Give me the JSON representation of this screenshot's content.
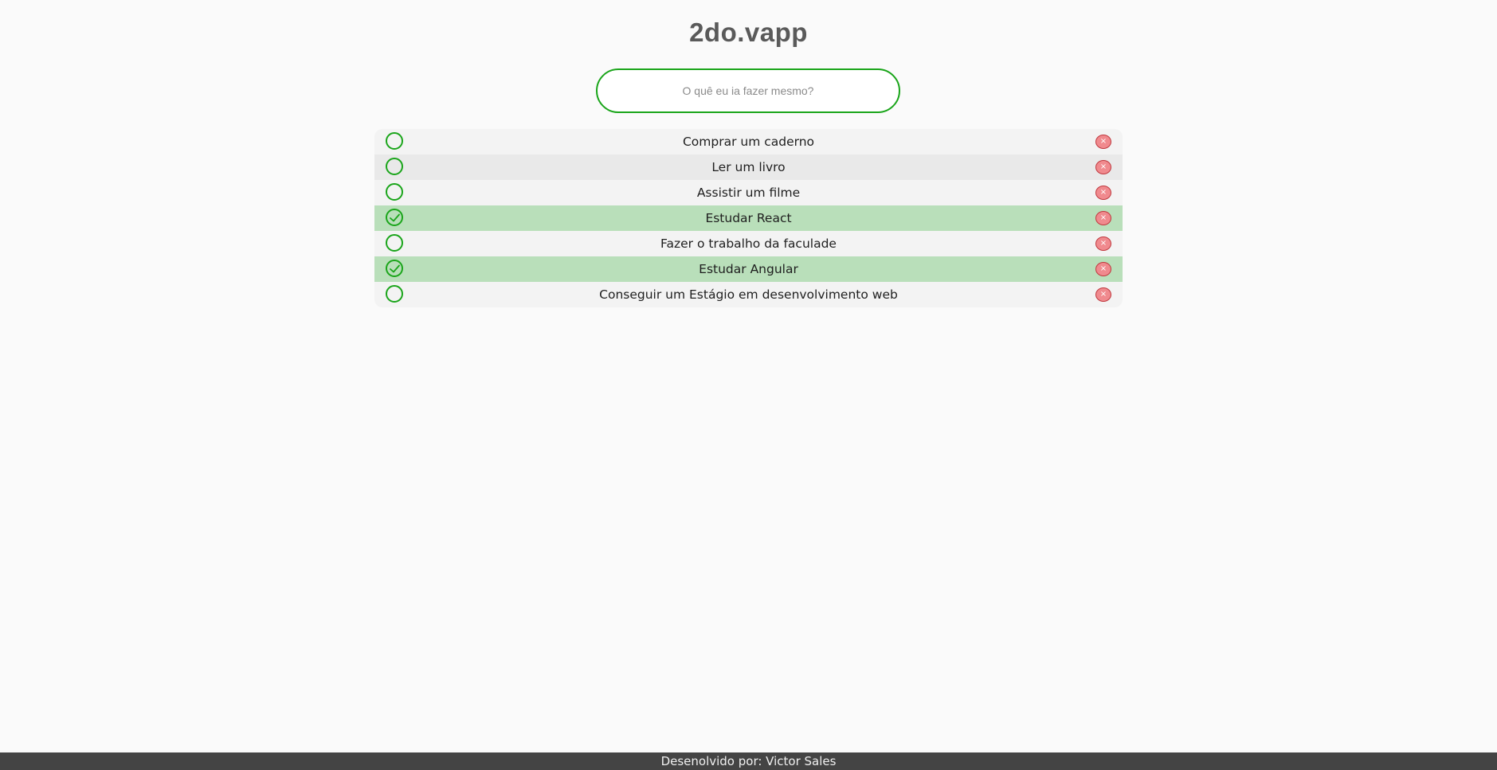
{
  "app": {
    "title": "2do.vapp"
  },
  "input": {
    "placeholder": "O quê eu ia fazer mesmo?",
    "value": ""
  },
  "colors": {
    "accent": "#1aa51a",
    "done_row": "#b9dfba",
    "delete": "#f08a8e",
    "footer": "#444444"
  },
  "tasks": [
    {
      "label": "Comprar um caderno",
      "done": false,
      "check_icon": "circle-outline-icon",
      "delete_icon": "close-icon"
    },
    {
      "label": "Ler um livro",
      "done": false,
      "check_icon": "circle-outline-icon",
      "delete_icon": "close-icon"
    },
    {
      "label": "Assistir um filme",
      "done": false,
      "check_icon": "circle-outline-icon",
      "delete_icon": "close-icon"
    },
    {
      "label": "Estudar React",
      "done": true,
      "check_icon": "check-circle-icon",
      "delete_icon": "close-icon"
    },
    {
      "label": "Fazer o trabalho da faculade",
      "done": false,
      "check_icon": "circle-outline-icon",
      "delete_icon": "close-icon"
    },
    {
      "label": "Estudar Angular",
      "done": true,
      "check_icon": "check-circle-icon",
      "delete_icon": "close-icon"
    },
    {
      "label": "Conseguir um Estágio em desenvolvimento web",
      "done": false,
      "check_icon": "circle-outline-icon",
      "delete_icon": "close-icon"
    }
  ],
  "footer": {
    "text": "Desenolvido por: Victor Sales"
  }
}
